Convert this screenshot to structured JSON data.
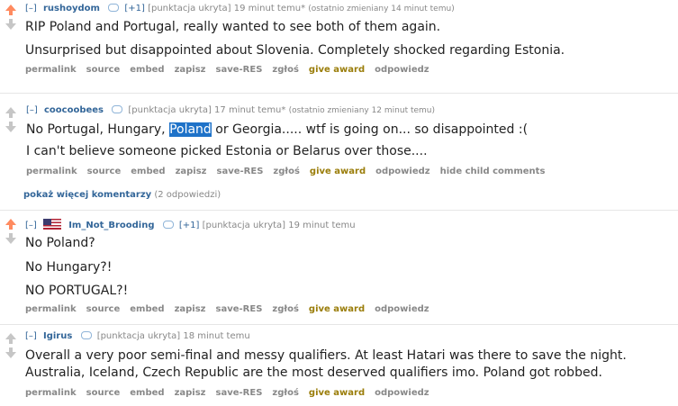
{
  "comments": [
    {
      "expand": "[–]",
      "author": "rushoydom",
      "score_link": "[+1]",
      "score_text": "[punktacja ukryta]",
      "time": "19 minut temu*",
      "edited": "(ostatnio zmieniany 14 minut temu)",
      "lines": [
        "RIP Poland and Portugal, really wanted to see both of them again.",
        "Unsurprised but disappointed about Slovenia. Completely shocked regarding Estonia."
      ],
      "buttons": [
        "permalink",
        "source",
        "embed",
        "zapisz",
        "save-RES",
        "zgłoś",
        "give award",
        "odpowiedz"
      ]
    },
    {
      "expand": "[–]",
      "author": "coocoobees",
      "score_text": "[punktacja ukryta]",
      "time": "17 minut temu*",
      "edited": "(ostatnio zmieniany 12 minut temu)",
      "line1_pre": "No Portugal, Hungary, ",
      "line1_hl": "Poland",
      "line1_post": " or Georgia..... wtf is going on... so disappointed :(",
      "line2": "I can't believe someone picked Estonia or Belarus over those....",
      "buttons": [
        "permalink",
        "source",
        "embed",
        "zapisz",
        "save-RES",
        "zgłoś",
        "give award",
        "odpowiedz",
        "hide child comments"
      ]
    },
    {
      "expand": "[–]",
      "author": "Im_Not_Brooding",
      "score_link": "[+1]",
      "score_text": "[punktacja ukryta]",
      "time": "19 minut temu",
      "lines": [
        "No Poland?",
        "No Hungary?!",
        "NO PORTUGAL?!"
      ],
      "buttons": [
        "permalink",
        "source",
        "embed",
        "zapisz",
        "save-RES",
        "zgłoś",
        "give award",
        "odpowiedz"
      ]
    },
    {
      "expand": "[–]",
      "author": "Igirus",
      "score_text": "[punktacja ukryta]",
      "time": "18 minut temu",
      "lines": [
        "Overall a very poor semi-final and messy qualifiers. At least Hatari was there to save the night.",
        "Australia, Iceland, Czech Republic are the most deserved qualifiers imo. Poland got robbed."
      ],
      "buttons": [
        "permalink",
        "source",
        "embed",
        "zapisz",
        "save-RES",
        "zgłoś",
        "give award",
        "odpowiedz"
      ]
    }
  ],
  "more_comments": {
    "link": "pokaż więcej komentarzy",
    "count": "(2 odpowiedzi)"
  },
  "colors": {
    "link": "#336699",
    "upvoted": "#ff8b60",
    "award": "#9a7d0a",
    "highlight": "#1e72c8"
  }
}
